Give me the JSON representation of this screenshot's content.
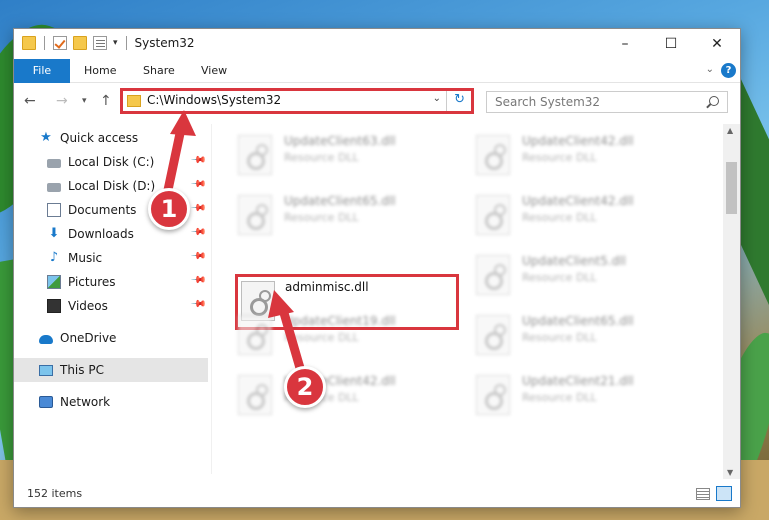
{
  "window": {
    "title": "System32"
  },
  "ribbon": {
    "tabs": [
      {
        "label": "File"
      },
      {
        "label": "Home"
      },
      {
        "label": "Share"
      },
      {
        "label": "View"
      }
    ]
  },
  "window_controls": {
    "minimize": "–",
    "maximize": "☐",
    "close": "✕"
  },
  "navbar": {
    "address": "C:\\Windows\\System32",
    "search_placeholder": "Search System32"
  },
  "sidebar": {
    "items": [
      {
        "label": "Quick access",
        "icon": "star-icon"
      },
      {
        "label": "Local Disk (C:)",
        "icon": "drive-icon",
        "pinned": true
      },
      {
        "label": "Local Disk (D:)",
        "icon": "drive-icon",
        "pinned": true
      },
      {
        "label": "Documents",
        "icon": "documents-icon",
        "pinned": true
      },
      {
        "label": "Downloads",
        "icon": "download-icon",
        "pinned": true
      },
      {
        "label": "Music",
        "icon": "music-icon",
        "pinned": true
      },
      {
        "label": "Pictures",
        "icon": "pictures-icon",
        "pinned": true
      },
      {
        "label": "Videos",
        "icon": "videos-icon",
        "pinned": true
      },
      {
        "label": "OneDrive",
        "icon": "onedrive-icon"
      },
      {
        "label": "This PC",
        "icon": "computer-icon",
        "selected": true
      },
      {
        "label": "Network",
        "icon": "network-icon"
      }
    ]
  },
  "files": [
    {
      "name": "UpdateClient63.dll",
      "type": "Resource DLL"
    },
    {
      "name": "UpdateClient42.dll",
      "type": "Resource DLL"
    },
    {
      "name": "UpdateClient65.dll",
      "type": "Resource DLL"
    },
    {
      "name": "UpdateClient42.dll",
      "type": "Resource DLL"
    },
    {
      "name": "adminmisc.dll",
      "type": ""
    },
    {
      "name": "UpdateClient5.dll",
      "type": "Resource DLL"
    },
    {
      "name": "UpdateClient19.dll",
      "type": "Resource DLL"
    },
    {
      "name": "UpdateClient65.dll",
      "type": "Resource DLL"
    },
    {
      "name": "UpdateClient42.dll",
      "type": "Resource DLL"
    },
    {
      "name": "UpdateClient21.dll",
      "type": "Resource DLL"
    }
  ],
  "status": {
    "item_count": "152 items"
  },
  "annotations": {
    "step1": "1",
    "step2": "2",
    "color": "#d9363e"
  },
  "colors": {
    "accent": "#1979ca",
    "highlight": "#d9363e"
  }
}
